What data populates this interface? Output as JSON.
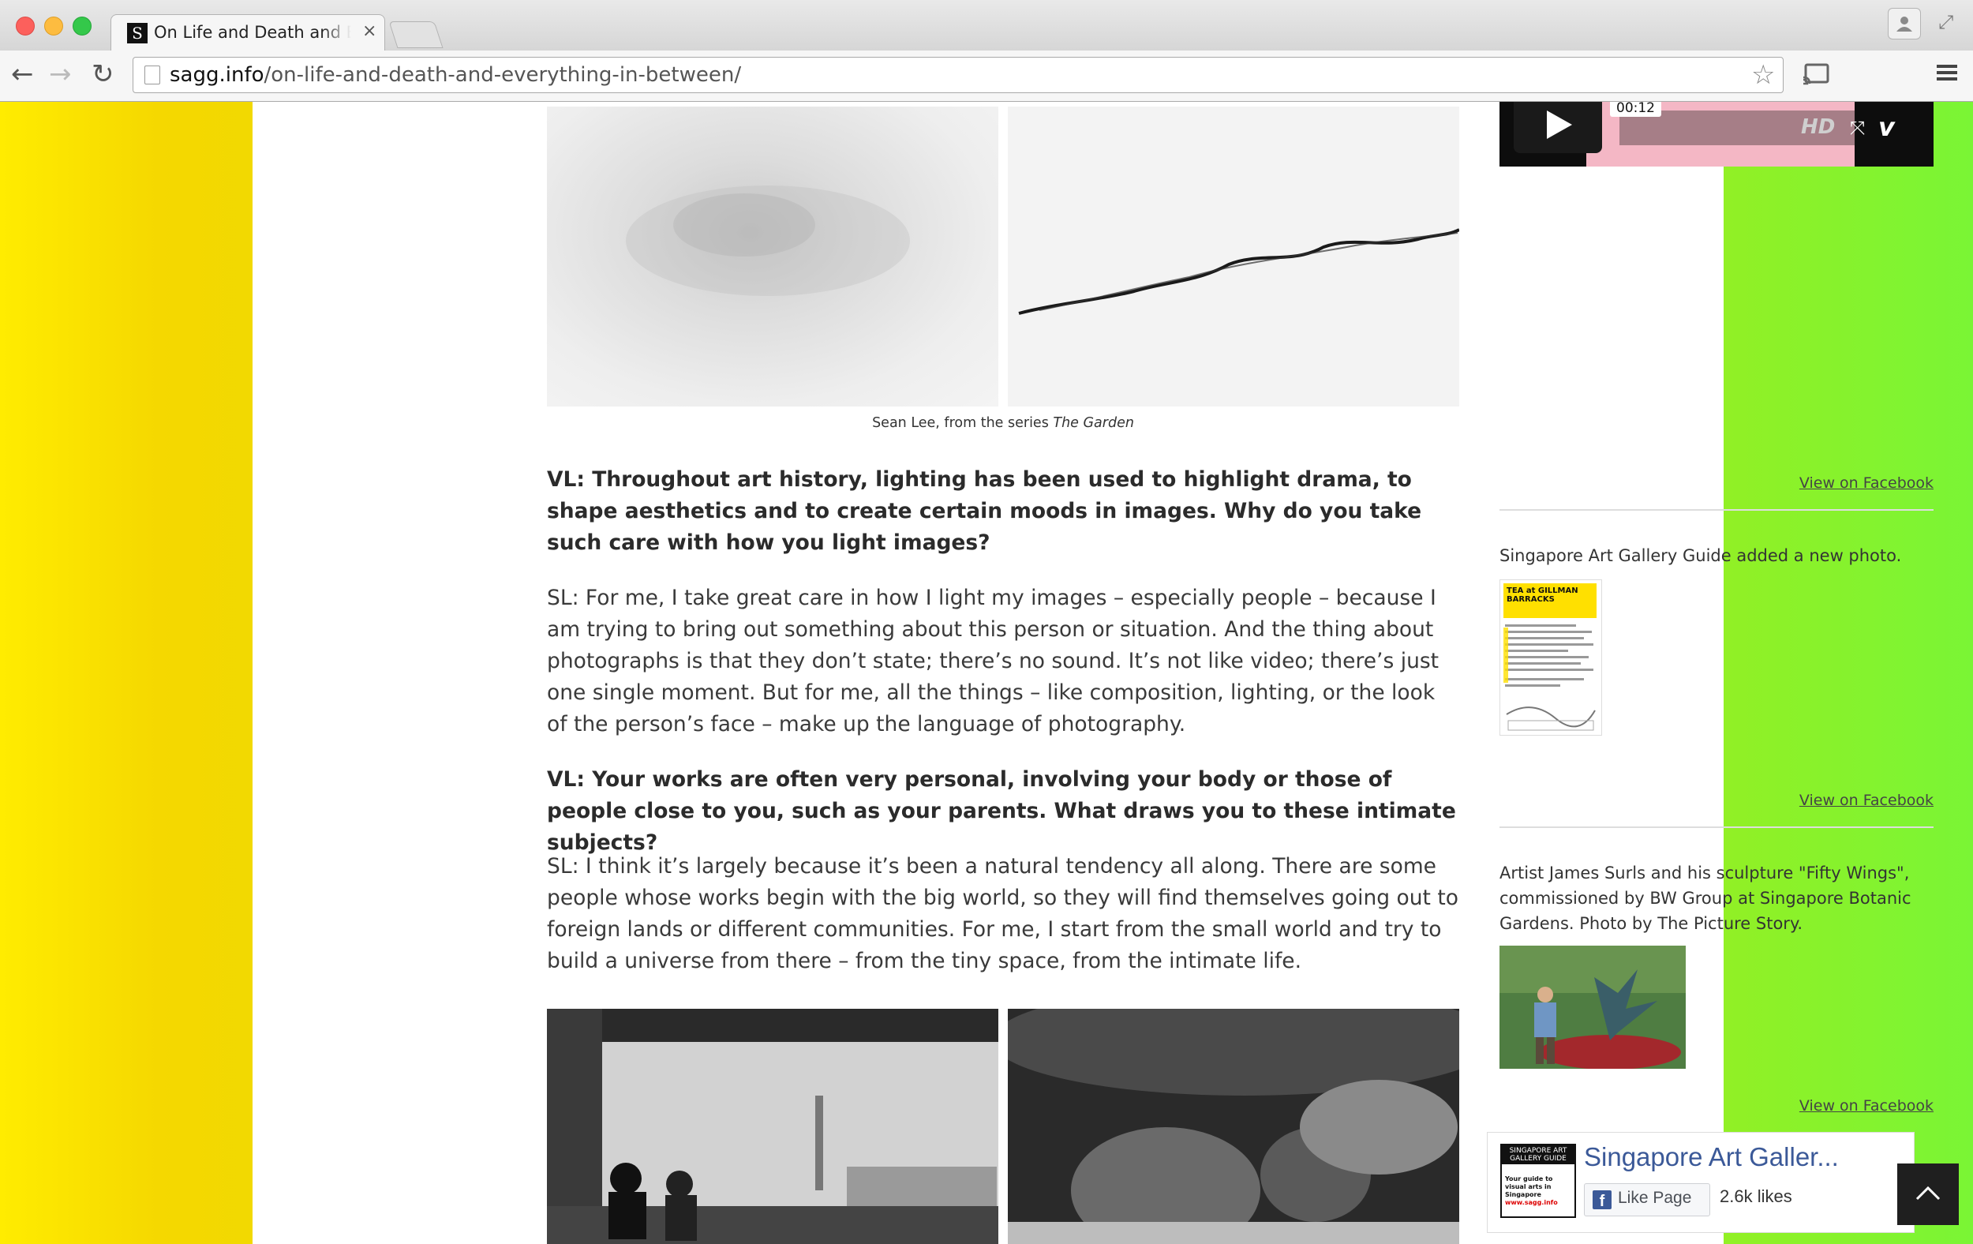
{
  "browser": {
    "tab_title": "On Life and Death and Everything in Between",
    "tab_favicon": "S",
    "tab_close": "×",
    "url_domain": "sagg.info",
    "url_path": "/on-life-and-death-and-everything-in-between/",
    "icons": [
      "back-arrow-icon",
      "forward-arrow-icon",
      "reload-icon",
      "page-icon",
      "star-icon",
      "cast-icon",
      "menu-icon",
      "profile-icon",
      "fullscreen-icon"
    ]
  },
  "article": {
    "caption_prefix": "Sean Lee, from the series ",
    "caption_series": "The Garden",
    "q1": "VL: Throughout art history, lighting has been used to highlight drama, to shape aesthetics and to create certain moods in images. Why do you take such care with how you light images?",
    "a1": "SL: For me, I take great care in how I light my images – especially people – because I am trying to bring out something about this person or situation. And the thing about photographs is that they don’t state; there’s no sound. It’s not like video; there’s just one single moment. But for me, all the things – like composition, lighting, or the look of the person’s face – make up the language of photography.",
    "q2": "VL: Your works are often very personal, involving your body or those of people close to you, such as your parents. What draws you to these intimate subjects?",
    "a2": "SL: I think it’s largely because it’s been a natural tendency all along. There are some people whose works begin with the big world, so they will find themselves going out to foreign lands or different communities. For me, I start from the small world and try to build a universe from there – from the tiny space, from the intimate life."
  },
  "sidebar": {
    "video": {
      "time": "00:12",
      "hd": "HD",
      "brand": "v"
    },
    "view_on_facebook": "View on Facebook",
    "post1": "Singapore Art Gallery Guide added a new photo.",
    "flyer_title": "TEA at GILLMAN BARRACKS",
    "post2": "Artist James Surls and his sculpture \"Fifty Wings\", commissioned by BW Group at Singapore Botanic Gardens. Photo by The Picture Story.",
    "fb_widget": {
      "page_name": "Singapore Art Galler...",
      "like_label": "Like Page",
      "likes": "2.6k likes",
      "logo_line1": "SINGAPORE ART",
      "logo_line2": "GALLERY GUIDE",
      "logo_tag": "Your guide to visual arts in Singapore",
      "logo_url": "www.sagg.info"
    }
  },
  "colors": {
    "bg_left": "#ffec00",
    "bg_right": "#7af535",
    "fb_blue": "#3b5998"
  }
}
